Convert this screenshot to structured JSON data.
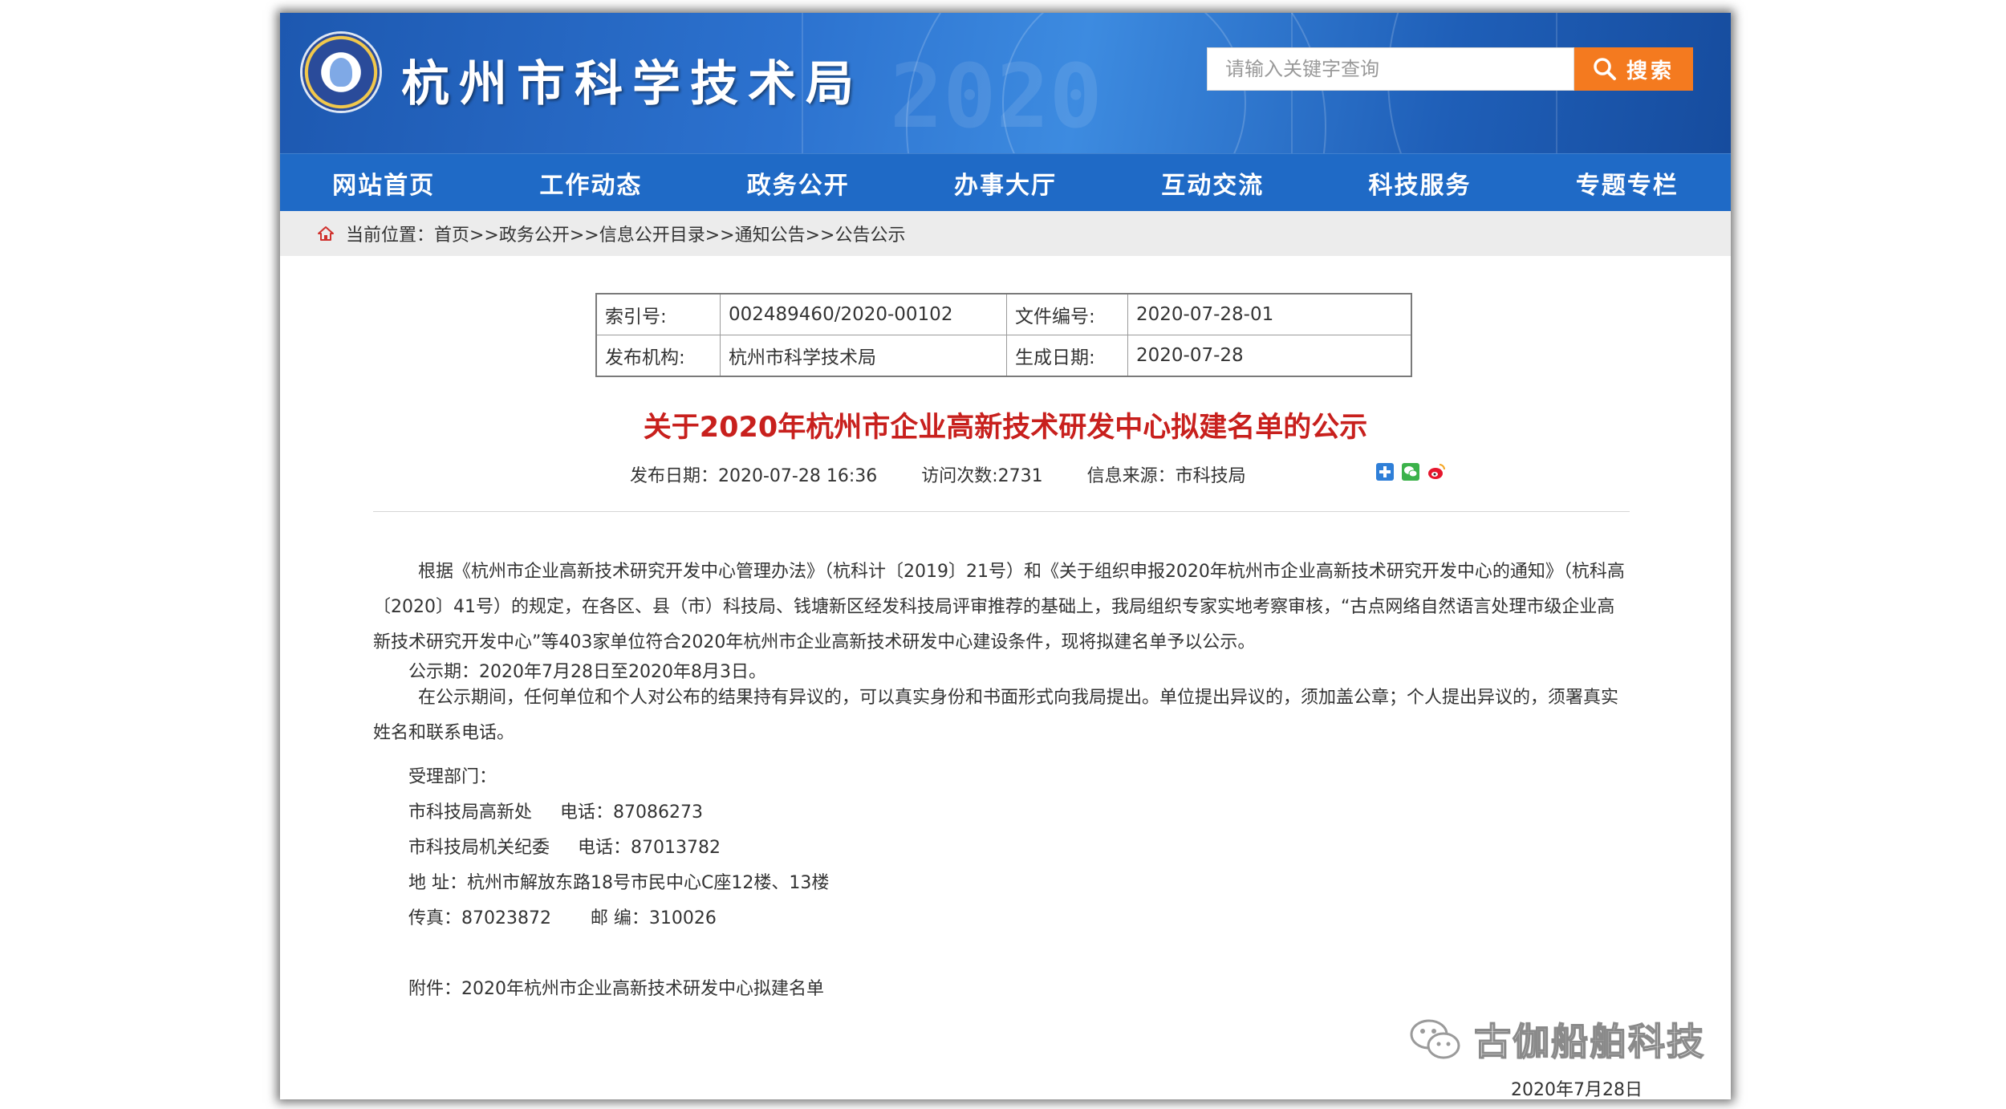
{
  "header": {
    "site_title": "杭州市科学技术局",
    "search_placeholder": "请输入关键字查询",
    "search_button": "搜索",
    "decor_text": "2020"
  },
  "nav": {
    "items": [
      "网站首页",
      "工作动态",
      "政务公开",
      "办事大厅",
      "互动交流",
      "科技服务",
      "专题专栏"
    ]
  },
  "breadcrumb": {
    "text": "当前位置：首页>>政务公开>>信息公开目录>>通知公告>>公告公示"
  },
  "meta": {
    "index_label": "索引号:",
    "index_value": "002489460/2020-00102",
    "doc_no_label": "文件编号:",
    "doc_no_value": "2020-07-28-01",
    "publisher_label": "发布机构:",
    "publisher_value": "杭州市科学技术局",
    "date_label": "生成日期:",
    "date_value": "2020-07-28"
  },
  "article": {
    "title": "关于2020年杭州市企业高新技术研发中心拟建名单的公示",
    "publish_date": "发布日期：2020-07-28 16:36",
    "visits": "访问次数:2731",
    "source": "信息来源：市科技局",
    "para1": "        根据《杭州市企业高新技术研究开发中心管理办法》（杭科计〔2019〕21号）和《关于组织申报2020年杭州市企业高新技术研究开发中心的通知》（杭科高〔2020〕41号）的规定，在各区、县（市）科技局、钱塘新区经发科技局评审推荐的基础上，我局组织专家实地考察审核，“古点网络自然语言处理市级企业高新技术研究开发中心”等403家单位符合2020年杭州市企业高新技术研发中心建设条件，现将拟建名单予以公示。",
    "period": "公示期：2020年7月28日至2020年8月3日。",
    "para2": "        在公示期间，任何单位和个人对公布的结果持有异议的，可以真实身份和书面形式向我局提出。单位提出异议的，须加盖公章；个人提出异议的，须署真实姓名和联系电话。",
    "dept_label": "受理部门：",
    "dept1": "市科技局高新处     电话：87086273",
    "dept2": "市科技局机关纪委     电话：87013782",
    "address": "地 址：杭州市解放东路18号市民中心C座12楼、13楼",
    "fax": "传真：87023872       邮 编：310026",
    "attachment": "附件：2020年杭州市企业高新技术研发中心拟建名单"
  },
  "watermark": {
    "text": "古伽船舶科技"
  },
  "footer": {
    "date": "2020年7月28日"
  },
  "colors": {
    "header_blue": "#2c72cf",
    "nav_blue": "#1f6ac6",
    "search_orange": "#f47a1f",
    "title_red": "#c8201d"
  },
  "icons": [
    "logo-emblem-icon",
    "search-icon",
    "home-icon",
    "share-plus-icon",
    "wechat-share-icon",
    "weibo-share-icon",
    "wechat-watermark-icon"
  ]
}
